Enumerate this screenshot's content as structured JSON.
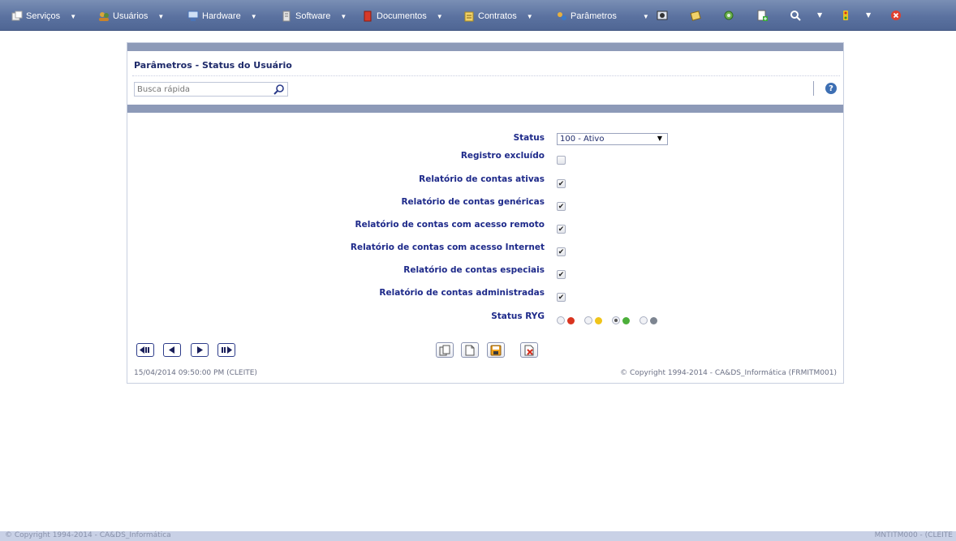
{
  "menu": {
    "items": [
      {
        "label": "Serviços",
        "icon": "services-icon",
        "color": "#e8e8e8"
      },
      {
        "label": "Usuários",
        "icon": "users-icon",
        "color": "#d9b44a"
      },
      {
        "label": "Hardware",
        "icon": "hardware-icon",
        "color": "#8fb3e6"
      },
      {
        "label": "Software",
        "icon": "software-icon",
        "color": "#c9c9c9"
      },
      {
        "label": "Documentos",
        "icon": "documents-icon",
        "color": "#d63a2a"
      },
      {
        "label": "Contratos",
        "icon": "contracts-icon",
        "color": "#e6c04a"
      },
      {
        "label": "Parâmetros",
        "icon": "parameters-icon",
        "color": "#e6b040"
      }
    ]
  },
  "panel": {
    "title": "Parâmetros - Status do Usuário",
    "search_placeholder": "Busca rápida",
    "help_glyph": "?"
  },
  "form": {
    "status_label": "Status",
    "status_value": "100 - Ativo",
    "rows": [
      {
        "label": "Registro excluído",
        "checked": false
      },
      {
        "label": "Relatório de contas ativas",
        "checked": true
      },
      {
        "label": "Relatório de contas genéricas",
        "checked": true
      },
      {
        "label": "Relatório de contas com acesso remoto",
        "checked": true
      },
      {
        "label": "Relatório de contas com acesso Internet",
        "checked": true
      },
      {
        "label": "Relatório de contas especiais",
        "checked": true
      },
      {
        "label": "Relatório de contas administradas",
        "checked": true
      }
    ],
    "ryg_label": "Status RYG",
    "ryg_options": [
      {
        "color": "#d9341f",
        "selected": false
      },
      {
        "color": "#f0c419",
        "selected": false
      },
      {
        "color": "#4caf3a",
        "selected": true
      },
      {
        "color": "#7d8591",
        "selected": false
      }
    ]
  },
  "footer": {
    "timestamp": "15/04/2014  09:50:00 PM (CLEITE)",
    "copyright": "© Copyright 1994-2014 - CA&DS_Informática (FRMITM001)"
  },
  "bottom_bar": {
    "left": "© Copyright 1994-2014 - CA&DS_Informática",
    "right": "MNTITM000 - (CLEITE"
  },
  "colors": {
    "menu_bar": "#5b72a0",
    "panel_band": "#8d9ab8",
    "label_text": "#1e2a8a"
  }
}
